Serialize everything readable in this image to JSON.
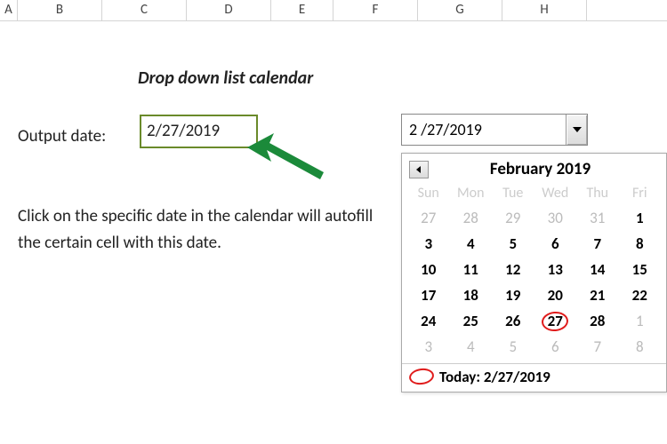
{
  "columns": [
    "A",
    "B",
    "C",
    "D",
    "E",
    "F",
    "G",
    "H"
  ],
  "title": "Drop down list calendar",
  "output_label": "Output date:",
  "output_value": "2/27/2019",
  "instructions": "Click on the specific date in the calendar will autofill the certain cell with this date.",
  "dropdown": {
    "value": "2 /27/2019"
  },
  "calendar": {
    "title": "February 2019",
    "dow": [
      "Sun",
      "Mon",
      "Tue",
      "Wed",
      "Thu",
      "Fri"
    ],
    "rows": [
      [
        {
          "n": 27,
          "dim": true
        },
        {
          "n": 28,
          "dim": true
        },
        {
          "n": 29,
          "dim": true
        },
        {
          "n": 30,
          "dim": true
        },
        {
          "n": 31,
          "dim": true
        },
        {
          "n": 1
        }
      ],
      [
        {
          "n": 3
        },
        {
          "n": 4
        },
        {
          "n": 5
        },
        {
          "n": 6
        },
        {
          "n": 7
        },
        {
          "n": 8
        }
      ],
      [
        {
          "n": 10
        },
        {
          "n": 11
        },
        {
          "n": 12
        },
        {
          "n": 13
        },
        {
          "n": 14
        },
        {
          "n": 15
        }
      ],
      [
        {
          "n": 17
        },
        {
          "n": 18
        },
        {
          "n": 19
        },
        {
          "n": 20
        },
        {
          "n": 21
        },
        {
          "n": 22
        }
      ],
      [
        {
          "n": 24
        },
        {
          "n": 25
        },
        {
          "n": 26
        },
        {
          "n": 27,
          "sel": true
        },
        {
          "n": 28
        },
        {
          "n": 1,
          "dim": true
        }
      ],
      [
        {
          "n": 3,
          "dim": true
        },
        {
          "n": 4,
          "dim": true
        },
        {
          "n": 5,
          "dim": true
        },
        {
          "n": 6,
          "dim": true
        },
        {
          "n": 7,
          "dim": true
        },
        {
          "n": 8,
          "dim": true
        }
      ]
    ],
    "today_label": "Today: 2/27/2019"
  }
}
